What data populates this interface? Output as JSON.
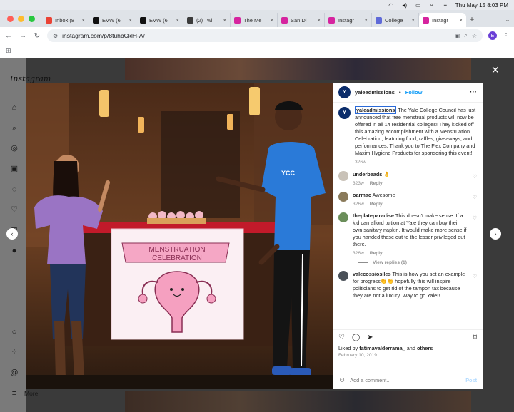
{
  "menubar": {
    "datetime": "Thu May 15  8:03 PM",
    "icons": [
      "wifi-icon",
      "volume-icon",
      "battery-icon",
      "search-icon",
      "control-center-icon"
    ]
  },
  "tabs": [
    {
      "label": "Inbox (8",
      "fav_color": "#ea4335",
      "active": false
    },
    {
      "label": "EVW (6",
      "fav_color": "#111111",
      "active": false
    },
    {
      "label": "EVW (6",
      "fav_color": "#111111",
      "active": false
    },
    {
      "label": "(2) Twi",
      "fav_color": "#3b3b3b",
      "active": false
    },
    {
      "label": "The Me",
      "fav_color": "#d6249f",
      "active": false
    },
    {
      "label": "San Di",
      "fav_color": "#d6249f",
      "active": false
    },
    {
      "label": "Instagr",
      "fav_color": "#d6249f",
      "active": false
    },
    {
      "label": "College",
      "fav_color": "#5f6ad8",
      "active": false
    },
    {
      "label": "Instagr",
      "fav_color": "#d6249f",
      "active": true
    }
  ],
  "toolbar": {
    "url": "instagram.com/p/8tuhbCklH-A/",
    "profile_initial": "E"
  },
  "sidebar": {
    "logo": "Instagram",
    "more": "More"
  },
  "post": {
    "username": "yaleadmissions",
    "follow": "Follow",
    "avatar_text": "Y",
    "caption": "The Yale College Council has just announced that free menstrual products will now be offered in all 14 residential colleges! They kicked off this amazing accomplishment with a Menstruation Celebration, featuring food, raffles, giveaways, and performances. Thank you to The Flex Company and Maxim Hygiene Products for sponsoring this event!",
    "caption_age": "326w",
    "liked_prefix": "Liked by ",
    "liked_user": "fatimavalderrama_",
    "liked_and": " and ",
    "liked_others": "others",
    "date": "February 10, 2019",
    "add_comment_placeholder": "Add a comment...",
    "post_label": "Post",
    "view_replies": "View replies (1)",
    "banner_line1": "MENSTRUATION",
    "banner_line2": "CELEBRATION",
    "shirt_text": "YCC"
  },
  "comments": [
    {
      "user": "underbeads",
      "text": "👌",
      "age": "323w",
      "reply": "Reply",
      "avatar_color": "#c9c2b8"
    },
    {
      "user": "oarmac",
      "text": "Awesome",
      "age": "326w",
      "reply": "Reply",
      "avatar_color": "#8a7a5a"
    },
    {
      "user": "theplateparadise",
      "text": "This doesn't make sense. If a kid can afford tuition at Yale they can buy their own sanitary napkin. It would make more sense if you handed these out to the lesser privileged out there.",
      "age": "326w",
      "reply": "Reply",
      "avatar_color": "#6b8e5a"
    },
    {
      "user": "valecossiosiles",
      "text": "This is how you set an example for progress👏👏 hopefully this will inspire politicians to get rid of the tampon tax because they are not a luxury. Way to go Yale!!",
      "age": "",
      "reply": "",
      "avatar_color": "#4a5058"
    }
  ]
}
